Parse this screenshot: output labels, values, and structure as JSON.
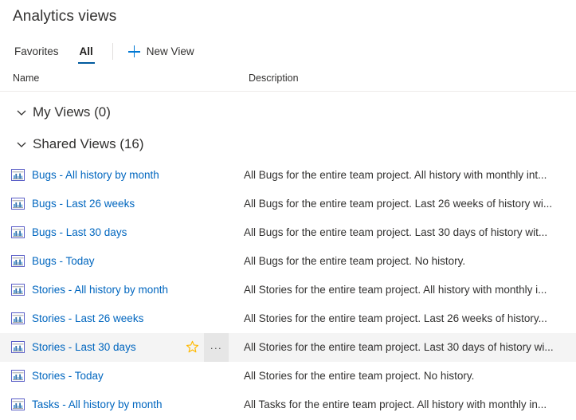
{
  "header": {
    "title": "Analytics views"
  },
  "commandbar": {
    "tabs": [
      {
        "label": "Favorites",
        "active": false
      },
      {
        "label": "All",
        "active": true
      }
    ],
    "new_view_label": "New View",
    "plus_icon": "plus-icon"
  },
  "columns": {
    "name": "Name",
    "description": "Description"
  },
  "groups": [
    {
      "label": "My Views (0)",
      "expanded": true,
      "chevron": "chevron-down-icon"
    },
    {
      "label": "Shared Views (16)",
      "expanded": true,
      "chevron": "chevron-down-icon"
    }
  ],
  "rows": [
    {
      "icon": "report-chart-icon",
      "name": "Bugs - All history by month",
      "description": "All Bugs for the entire team project. All history with monthly int...",
      "hovered": false
    },
    {
      "icon": "report-chart-icon",
      "name": "Bugs - Last 26 weeks",
      "description": "All Bugs for the entire team project. Last 26 weeks of history wi...",
      "hovered": false
    },
    {
      "icon": "report-chart-icon",
      "name": "Bugs - Last 30 days",
      "description": "All Bugs for the entire team project. Last 30 days of history wit...",
      "hovered": false
    },
    {
      "icon": "report-chart-icon",
      "name": "Bugs - Today",
      "description": "All Bugs for the entire team project. No history.",
      "hovered": false
    },
    {
      "icon": "report-chart-icon",
      "name": "Stories - All history by month",
      "description": "All Stories for the entire team project. All history with monthly i...",
      "hovered": false
    },
    {
      "icon": "report-chart-icon",
      "name": "Stories - Last 26 weeks",
      "description": "All Stories for the entire team project. Last 26 weeks of history...",
      "hovered": false
    },
    {
      "icon": "report-chart-icon",
      "name": "Stories - Last 30 days",
      "description": "All Stories for the entire team project. Last 30 days of history wi...",
      "hovered": true,
      "actions": {
        "favorite_icon": "star-icon",
        "more_label": "...",
        "more_icon": "more-actions-icon"
      }
    },
    {
      "icon": "report-chart-icon",
      "name": "Stories - Today",
      "description": "All Stories for the entire team project. No history.",
      "hovered": false
    },
    {
      "icon": "report-chart-icon",
      "name": "Tasks - All history by month",
      "description": "All Tasks for the entire team project. All history with monthly in...",
      "hovered": false
    }
  ],
  "colors": {
    "link": "#0066bf",
    "accent": "#0078d4",
    "tab_underline": "#005a9e",
    "text": "#323130",
    "hover_row_bg": "#f4f4f4",
    "more_button_bg": "#e6e6e6",
    "star": "#ffb900",
    "divider": "#edebe9"
  }
}
